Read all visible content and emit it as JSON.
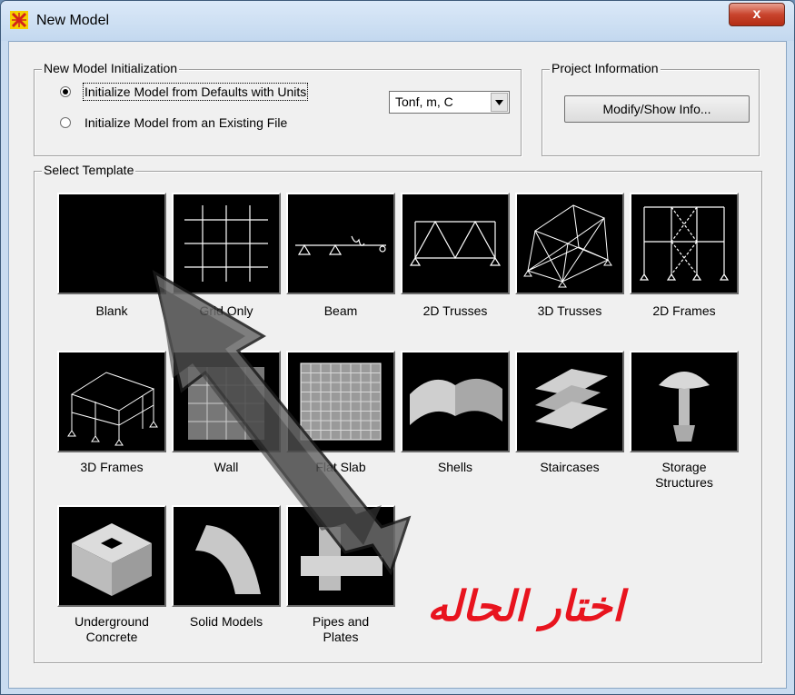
{
  "window": {
    "title": "New Model",
    "close_label": "x"
  },
  "init_group": {
    "legend": "New Model Initialization",
    "option_defaults": "Initialize Model from Defaults with Units",
    "option_existing": "Initialize Model  from an Existing File",
    "units_value": "Tonf, m, C"
  },
  "project_group": {
    "legend": "Project Information",
    "button_label": "Modify/Show Info..."
  },
  "template_group": {
    "legend": "Select Template",
    "tiles": [
      {
        "label": "Blank",
        "icon": "blank-icon"
      },
      {
        "label": "Grid Only",
        "icon": "grid-icon"
      },
      {
        "label": "Beam",
        "icon": "beam-icon"
      },
      {
        "label": "2D Trusses",
        "icon": "truss-2d-icon"
      },
      {
        "label": "3D Trusses",
        "icon": "truss-3d-icon"
      },
      {
        "label": "2D Frames",
        "icon": "frame-2d-icon"
      },
      {
        "label": "3D Frames",
        "icon": "frame-3d-icon"
      },
      {
        "label": "Wall",
        "icon": "wall-icon"
      },
      {
        "label": "Flat Slab",
        "icon": "flat-slab-icon"
      },
      {
        "label": "Shells",
        "icon": "shell-icon"
      },
      {
        "label": "Staircases",
        "icon": "staircase-icon"
      },
      {
        "label": "Storage Structures",
        "icon": "storage-icon"
      },
      {
        "label": "Underground Concrete",
        "icon": "underground-icon"
      },
      {
        "label": "Solid Models",
        "icon": "solid-icon"
      },
      {
        "label": "Pipes and Plates",
        "icon": "pipes-icon"
      }
    ]
  },
  "annotation": {
    "text": "اختار الحاله",
    "color": "#e8141e"
  }
}
